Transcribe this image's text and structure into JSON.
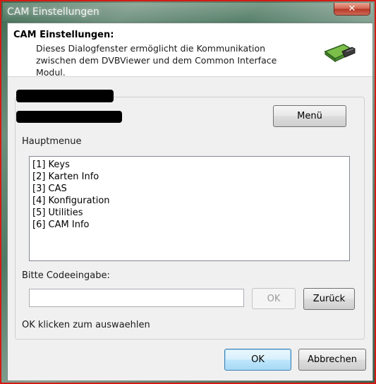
{
  "window": {
    "title": "CAM Einstellungen",
    "close_glyph": "✕"
  },
  "header": {
    "title": "CAM Einstellungen:",
    "description": "Dieses Dialogfenster ermöglicht die Kommunikation zwischen dem DVBViewer und dem Common Interface Modul.",
    "icon": "cam-module-icon"
  },
  "main": {
    "menu_button": "Menü",
    "list_label": "Hauptmenue",
    "menu_items": [
      {
        "label": "[1] Keys"
      },
      {
        "label": "[2] Karten Info"
      },
      {
        "label": "[3] CAS"
      },
      {
        "label": "[4] Konfiguration"
      },
      {
        "label": "[5] Utilities"
      },
      {
        "label": "[6] CAM Info"
      }
    ],
    "code_label": "Bitte Codeeingabe:",
    "code_value": "",
    "code_ok_button": "OK",
    "back_button": "Zurück",
    "hint": "OK klicken zum auswaehlen"
  },
  "footer": {
    "ok_button": "OK",
    "cancel_button": "Abbrechen"
  },
  "colors": {
    "frame": "#d41a14",
    "default_button": "#3c7fb1"
  }
}
